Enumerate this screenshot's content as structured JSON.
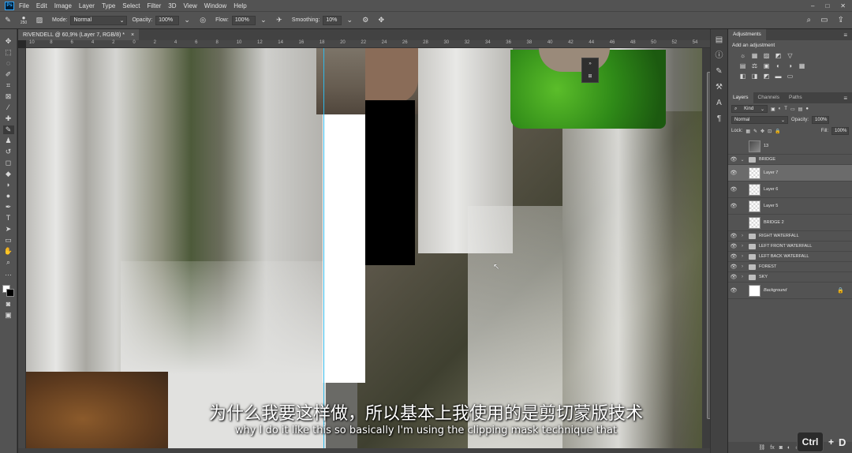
{
  "app": {
    "logo": "Ps",
    "menu": [
      "File",
      "Edit",
      "Image",
      "Layer",
      "Type",
      "Select",
      "Filter",
      "3D",
      "View",
      "Window",
      "Help"
    ],
    "window_controls": [
      "–",
      "□",
      "✕"
    ]
  },
  "options_bar": {
    "brush_size": "250",
    "mode_label": "Mode:",
    "mode_value": "Normal",
    "opacity_label": "Opacity:",
    "opacity_value": "100%",
    "flow_label": "Flow:",
    "flow_value": "100%",
    "smoothing_label": "Smoothing:",
    "smoothing_value": "10%"
  },
  "document": {
    "tab_title": "RIVENDELL @ 60,9% (Layer 7, RGB/8) *",
    "tab_close": "×"
  },
  "ruler": {
    "ticks": [
      "10",
      "8",
      "6",
      "4",
      "2",
      "0",
      "2",
      "4",
      "6",
      "8",
      "10",
      "12",
      "14",
      "16",
      "18",
      "20",
      "22",
      "24",
      "26",
      "28",
      "30",
      "32",
      "34",
      "36",
      "38",
      "40",
      "42",
      "44",
      "46",
      "48",
      "50",
      "52",
      "54"
    ]
  },
  "adjustments_panel": {
    "tab": "Adjustments",
    "title": "Add an adjustment",
    "row1": [
      "☼",
      "▦",
      "▨",
      "◩",
      "▽"
    ],
    "row2": [
      "▤",
      "⚖",
      "▣",
      "◐",
      "◑",
      "▦"
    ],
    "row3": [
      "◧",
      "◨",
      "◩",
      "▬",
      "▭"
    ]
  },
  "layers_panel": {
    "tabs": [
      "Layers",
      "Channels",
      "Paths"
    ],
    "kind_label": "Kind",
    "blend_mode": "Normal",
    "opacity_label": "Opacity:",
    "opacity_value": "100%",
    "lock_label": "Lock:",
    "fill_label": "Fill:",
    "fill_value": "100%",
    "layers": [
      {
        "name": "13",
        "type": "layer",
        "thumb": "dark",
        "visible": false,
        "indent": 0
      },
      {
        "name": "BRIDGE",
        "type": "group",
        "visible": true,
        "expanded": true
      },
      {
        "name": "Layer 7",
        "type": "layer",
        "thumb": "transparent",
        "visible": true,
        "active": true
      },
      {
        "name": "Layer 6",
        "type": "layer",
        "thumb": "transparent",
        "visible": true
      },
      {
        "name": "Layer 5",
        "type": "layer",
        "thumb": "transparent",
        "visible": true
      },
      {
        "name": "BRIDGE 2",
        "type": "layer",
        "thumb": "transparent",
        "visible": false
      },
      {
        "name": "RIGHT WATERFALL",
        "type": "group",
        "visible": true
      },
      {
        "name": "LEFT FRONT WATERFALL",
        "type": "group",
        "visible": true
      },
      {
        "name": "LEFT BACK WATERFALL",
        "type": "group",
        "visible": true
      },
      {
        "name": "FOREST",
        "type": "group",
        "visible": true
      },
      {
        "name": "SKY",
        "type": "group",
        "visible": true
      },
      {
        "name": "Background",
        "type": "layer",
        "thumb": "white",
        "visible": true,
        "locked": true
      }
    ]
  },
  "subtitles": {
    "zh": "为什么我要这样做，所以基本上我使用的是剪切蒙版技术",
    "en": "why I do it like this so basically I'm using the clipping mask technique that"
  },
  "shortcut": {
    "key": "Ctrl",
    "plus": "+",
    "letter": "D"
  }
}
